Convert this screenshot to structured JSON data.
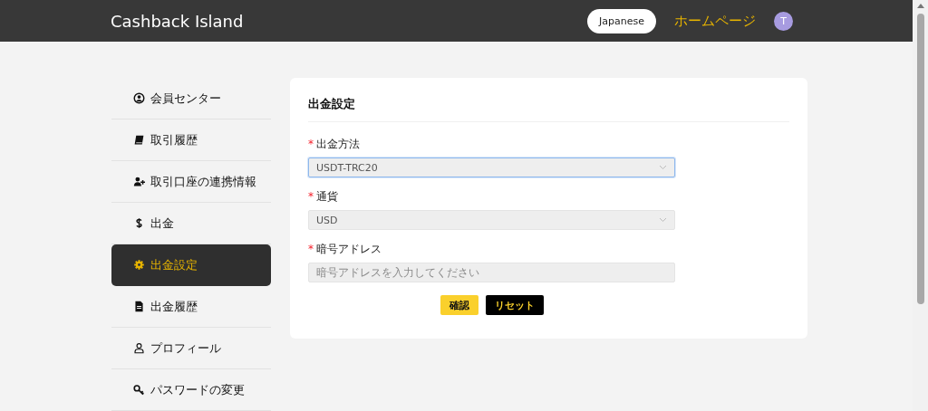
{
  "header": {
    "title": "Cashback Island",
    "language_button": "Japanese",
    "home_link": "ホームページ",
    "avatar": "T"
  },
  "sidebar": {
    "items": [
      {
        "label": "会員センター",
        "selected": false
      },
      {
        "label": "取引履歴",
        "selected": false
      },
      {
        "label": "取引口座の連携情報",
        "selected": false
      },
      {
        "label": "出金",
        "selected": false
      },
      {
        "label": "出金設定",
        "selected": true
      },
      {
        "label": "出金履歴",
        "selected": false
      },
      {
        "label": "プロフィール",
        "selected": false
      },
      {
        "label": "パスワードの変更",
        "selected": false
      }
    ]
  },
  "card": {
    "title": "出金設定",
    "fields": [
      {
        "kind": "select",
        "label": "出金方法",
        "required_mark": "*",
        "value": "USDT-TRC20",
        "focused": true
      },
      {
        "kind": "select",
        "label": "通貨",
        "required_mark": "*",
        "value": "USD",
        "focused": false
      },
      {
        "kind": "input",
        "label": "暗号アドレス",
        "required_mark": "*",
        "placeholder": "暗号アドレスを入力してください",
        "focused": false
      }
    ],
    "buttons": [
      {
        "label": "確認",
        "kind": "primary"
      },
      {
        "label": "リセット",
        "kind": "dark"
      }
    ]
  }
}
